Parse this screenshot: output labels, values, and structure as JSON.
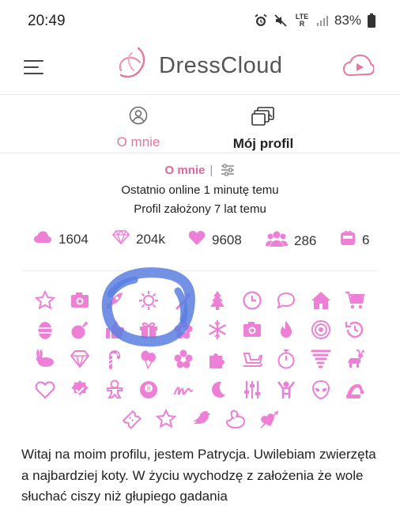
{
  "status_bar": {
    "time": "20:49",
    "network": "LTE R",
    "battery": "83%",
    "icons": [
      "alarm-icon",
      "mute-icon",
      "signal-icon",
      "battery-icon"
    ]
  },
  "header": {
    "app_name": "DressCloud",
    "icons": [
      "menu-icon",
      "dresscloud-logo-icon",
      "video-play-icon"
    ]
  },
  "tabs": [
    {
      "label": "O mnie",
      "icon": "user-circle-icon",
      "active": true
    },
    {
      "label": "Mój profil",
      "icon": "photos-icon",
      "active": false
    }
  ],
  "profile": {
    "about_label": "O mnie",
    "separator": "|",
    "last_online": "Ostatnio online 1 minutę temu",
    "created": "Profil założony 7 lat temu"
  },
  "stats": [
    {
      "icon": "cloud-icon",
      "value": "1604"
    },
    {
      "icon": "diamond-icon",
      "value": "204k"
    },
    {
      "icon": "heart-icon",
      "value": "9608"
    },
    {
      "icon": "users-icon",
      "value": "286"
    },
    {
      "icon": "gift-box-icon",
      "value": "6"
    }
  ],
  "badges": [
    "star-icon",
    "camera-icon",
    "rocket-icon",
    "sun-icon",
    "magic-wand-icon",
    "tree-icon",
    "clock-icon",
    "speech-bubble-icon",
    "house-icon",
    "cart-icon",
    "easter-egg-icon",
    "bomb-icon",
    "thumbs-up-icon",
    "present-icon",
    "flower-icon",
    "snowflake-icon",
    "camera-icon",
    "fire-icon",
    "target-icon",
    "history-icon",
    "bunny-icon",
    "diamond-icon",
    "candy-cane-icon",
    "balloons-icon",
    "flower-icon",
    "puzzle-icon",
    "sleigh-icon",
    "stopwatch-icon",
    "tornado-icon",
    "reindeer-icon",
    "heart-outline-icon",
    "check-badge-icon",
    "gingerbread-icon",
    "eight-ball-icon",
    "signature-icon",
    "moon-icon",
    "sliders-icon",
    "person-raised-icon",
    "alien-icon",
    "santa-hat-icon",
    "ticket-icon",
    "star-icon",
    "bird-icon",
    "duck-icon",
    "heart-arrow-icon"
  ],
  "bio": {
    "text": "Witaj na moim profilu, jestem Patrycja. Uwilebiam zwierzęta a najbardziej koty. W życiu wychodzę z założenia że wole słuchać ciszy niż głupiego gadania"
  },
  "colors": {
    "accent": "#e8729d",
    "badge_pink": "#ee7fd6",
    "scribble_blue": "#5b7fe0"
  }
}
